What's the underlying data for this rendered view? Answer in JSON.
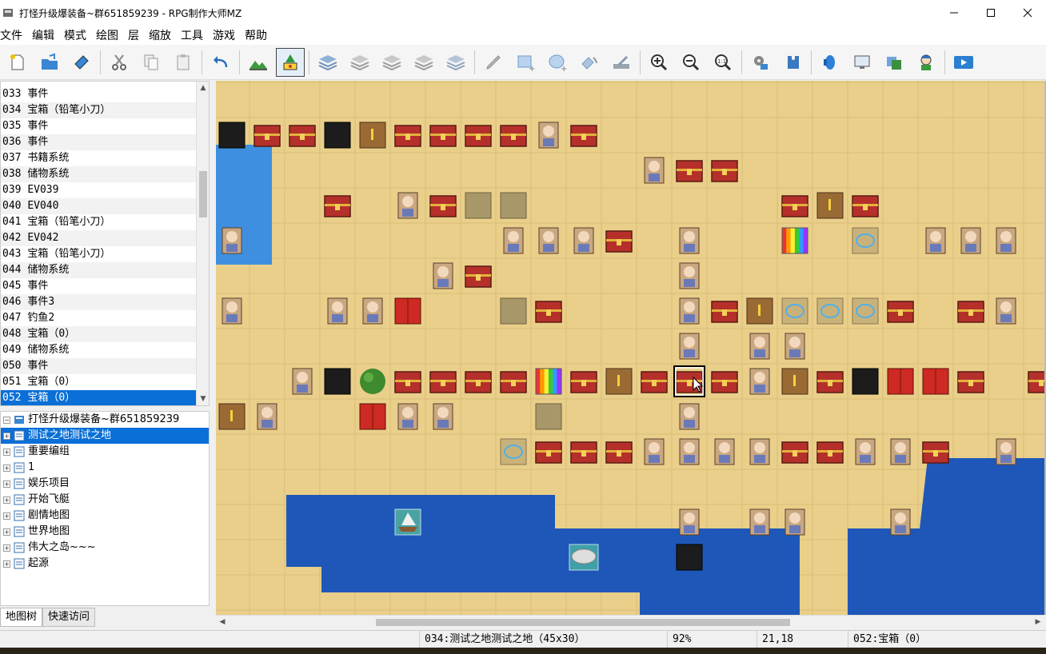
{
  "window": {
    "title": "打怪升级爆装备~群651859239 - RPG制作大师MZ"
  },
  "menu": [
    "文件",
    "编辑",
    "模式",
    "绘图",
    "层",
    "缩放",
    "工具",
    "游戏",
    "帮助"
  ],
  "events": [
    {
      "id": "033",
      "name": "事件"
    },
    {
      "id": "034",
      "name": "宝箱（铅笔小刀）"
    },
    {
      "id": "035",
      "name": "事件"
    },
    {
      "id": "036",
      "name": "事件"
    },
    {
      "id": "037",
      "name": "书籍系统"
    },
    {
      "id": "038",
      "name": "储物系统"
    },
    {
      "id": "039",
      "name": "EV039"
    },
    {
      "id": "040",
      "name": "EV040"
    },
    {
      "id": "041",
      "name": "宝箱（铅笔小刀）"
    },
    {
      "id": "042",
      "name": "EV042"
    },
    {
      "id": "043",
      "name": "宝箱（铅笔小刀）"
    },
    {
      "id": "044",
      "name": "储物系统"
    },
    {
      "id": "045",
      "name": "事件"
    },
    {
      "id": "046",
      "name": "事件3"
    },
    {
      "id": "047",
      "name": "钓鱼2"
    },
    {
      "id": "048",
      "name": "宝箱（0）"
    },
    {
      "id": "049",
      "name": "储物系统"
    },
    {
      "id": "050",
      "name": "事件"
    },
    {
      "id": "051",
      "name": "宝箱（0）"
    },
    {
      "id": "052",
      "name": "宝箱（0）"
    }
  ],
  "tree": {
    "root": "打怪升级爆装备~群651859239",
    "maps": [
      "测试之地测试之地",
      "重要编组",
      "1",
      "娱乐项目",
      "开始飞艇",
      "剧情地图",
      "世界地图",
      "伟大之岛~~~",
      "起源"
    ]
  },
  "tabs": [
    "地图树",
    "快速访问"
  ],
  "status": {
    "map": "034:测试之地测试之地（45x30）",
    "zoom": "92%",
    "coords": "21,18",
    "event": "052:宝箱（0）"
  },
  "colors": {
    "selection": "#0a6fd6",
    "sand": "#e9cf8a",
    "water": "#1f57b8"
  },
  "icons": [
    "new-project-icon",
    "open-project-icon",
    "save-project-icon",
    "cut-icon",
    "copy-icon",
    "paste-icon",
    "undo-icon",
    "map-mode-icon",
    "event-mode-icon",
    "layer-1-icon",
    "layer-2-icon",
    "layer-3-icon",
    "layer-4-icon",
    "layer-auto-icon",
    "pencil-icon",
    "rectangle-icon",
    "ellipse-icon",
    "fill-icon",
    "shadow-pen-icon",
    "zoom-in-icon",
    "zoom-out-icon",
    "zoom-actual-icon",
    "database-icon",
    "plugin-icon",
    "sound-test-icon",
    "event-searcher-icon",
    "resource-manager-icon",
    "character-generator-icon",
    "playtest-icon"
  ]
}
